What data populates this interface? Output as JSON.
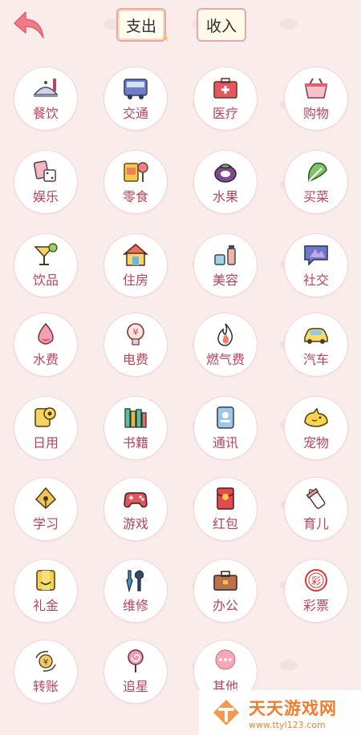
{
  "header": {
    "tab_pay": "支出",
    "tab_income": "收入",
    "active_tab": "支出"
  },
  "categories": [
    {
      "label": "餐饮",
      "icon": "dining-icon"
    },
    {
      "label": "交通",
      "icon": "bus-icon"
    },
    {
      "label": "医疗",
      "icon": "medkit-icon"
    },
    {
      "label": "购物",
      "icon": "basket-icon"
    },
    {
      "label": "娱乐",
      "icon": "dice-cards-icon"
    },
    {
      "label": "零食",
      "icon": "snack-icon"
    },
    {
      "label": "水果",
      "icon": "mangosteen-icon"
    },
    {
      "label": "买菜",
      "icon": "vegetable-icon"
    },
    {
      "label": "饮品",
      "icon": "cocktail-icon"
    },
    {
      "label": "住房",
      "icon": "house-icon"
    },
    {
      "label": "美容",
      "icon": "cosmetics-icon"
    },
    {
      "label": "社交",
      "icon": "chat-icon"
    },
    {
      "label": "水费",
      "icon": "water-drop-icon"
    },
    {
      "label": "电费",
      "icon": "lightbulb-icon"
    },
    {
      "label": "燃气费",
      "icon": "flame-icon"
    },
    {
      "label": "汽车",
      "icon": "car-icon"
    },
    {
      "label": "日用",
      "icon": "toilet-paper-icon"
    },
    {
      "label": "书籍",
      "icon": "books-icon"
    },
    {
      "label": "通讯",
      "icon": "phone-book-icon"
    },
    {
      "label": "宠物",
      "icon": "pet-icon"
    },
    {
      "label": "学习",
      "icon": "pen-nib-icon"
    },
    {
      "label": "游戏",
      "icon": "gamepad-icon"
    },
    {
      "label": "红包",
      "icon": "red-envelope-icon"
    },
    {
      "label": "育儿",
      "icon": "baby-bottle-icon"
    },
    {
      "label": "礼金",
      "icon": "gift-money-icon"
    },
    {
      "label": "维修",
      "icon": "tools-icon"
    },
    {
      "label": "办公",
      "icon": "briefcase-icon"
    },
    {
      "label": "彩票",
      "icon": "lottery-icon"
    },
    {
      "label": "转账",
      "icon": "transfer-icon"
    },
    {
      "label": "追星",
      "icon": "lollipop-icon"
    },
    {
      "label": "其他",
      "icon": "more-icon"
    }
  ],
  "watermark": {
    "title": "天天游戏网",
    "url": "www.ttyl123.com"
  },
  "colors": {
    "background": "#fbecec",
    "label": "#b8435a",
    "tab_border": "#e6a7b0",
    "back_arrow": "#f07a86"
  }
}
